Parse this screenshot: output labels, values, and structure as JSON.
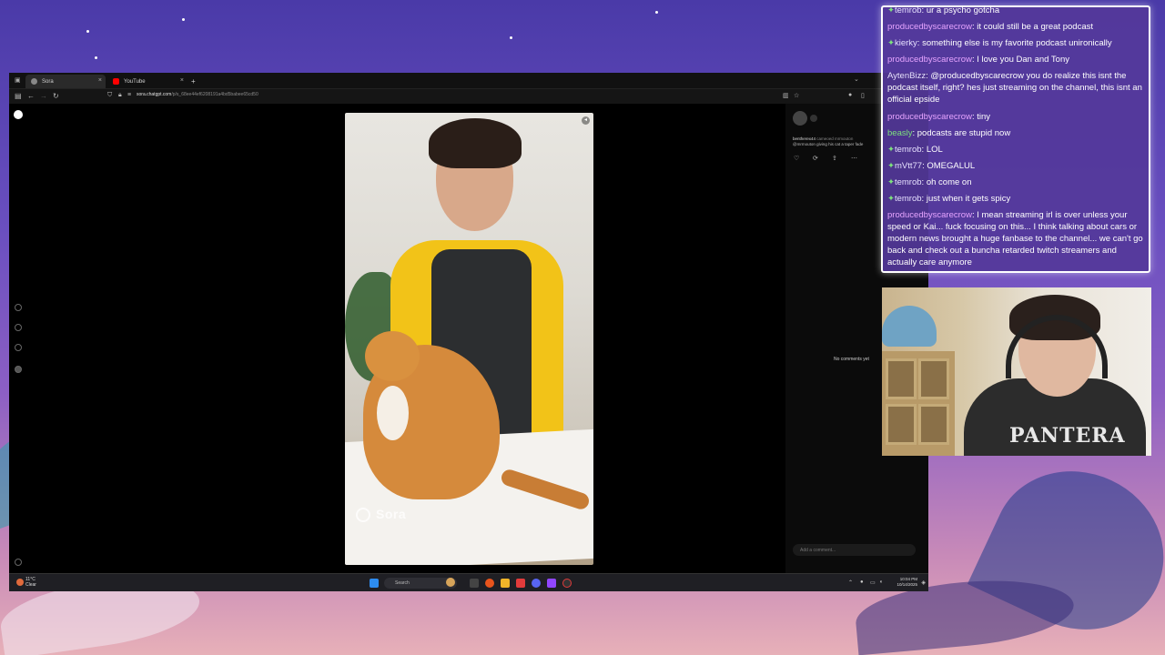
{
  "browser": {
    "tabs": [
      {
        "label": "Sora",
        "fav_color": "#888888"
      },
      {
        "label": "YouTube",
        "fav_color": "#ff0000"
      }
    ],
    "new_tab": "+",
    "url": {
      "domain": "sora.chatgpt.com",
      "path": "/p/s_68ee44ef6208191a4bd5babee65cd50"
    }
  },
  "video": {
    "watermark": "Sora"
  },
  "comments_panel": {
    "author": "bentherex44",
    "cameo_text": "cameoed mrmouton",
    "caption": "@mrmouton giving his cat a taper fade",
    "no_comments": "No comments yet",
    "add_comment_placeholder": "Add a comment..."
  },
  "taskbar": {
    "weather_temp": "11°C",
    "weather_desc": "Clear",
    "search_label": "Search",
    "time": "10:04 PM",
    "date": "10/14/2025"
  },
  "chat": {
    "messages": [
      {
        "user": "temrob",
        "text": "ur a psycho gotcha",
        "style": "badge"
      },
      {
        "user": "producedbyscarecrow",
        "text": "it could still be a great podcast",
        "style": "pink"
      },
      {
        "user": "kierky",
        "text": "something else is my favorite podcast unironically",
        "style": "badge"
      },
      {
        "user": "producedbyscarecrow",
        "text": "I love you Dan and Tony",
        "style": "pink"
      },
      {
        "user": "AytenBizz",
        "text": "@producedbyscarecrow you do realize this isnt the podcast itself, right? hes just streaming on the channel, this isnt an official epside",
        "style": "grey"
      },
      {
        "user": "producedbyscarecrow",
        "text": "tiny",
        "style": "pink"
      },
      {
        "user": "beasly",
        "text": "podcasts are stupid now",
        "style": "green"
      },
      {
        "user": "temrob",
        "text": "LOL",
        "style": "badge"
      },
      {
        "user": "mVtt77",
        "text": "OMEGALUL",
        "style": "badge"
      },
      {
        "user": "temrob",
        "text": "oh come on",
        "style": "badge"
      },
      {
        "user": "temrob",
        "text": "just when it gets spicy",
        "style": "badge"
      },
      {
        "user": "producedbyscarecrow",
        "text": "I mean streaming irl is over unless your speed or Kai... fuck focusing on this... I think talking about cars or modern news brought a huge fanbase to the channel... we can't go back and check out a buncha retarded twitch streamers and actually care anymore",
        "style": "pink"
      }
    ]
  },
  "webcam": {
    "shirt_text": "PANTERA"
  },
  "colors": {
    "chat_bg": "#54389a",
    "username_pink": "#e6a4ff",
    "username_green": "#7de07d"
  }
}
